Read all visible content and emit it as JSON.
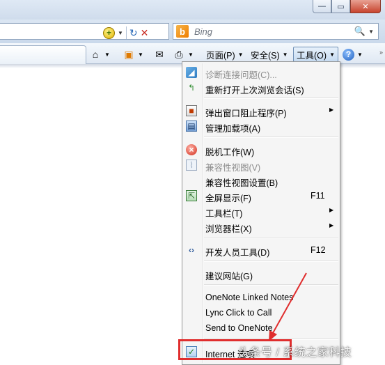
{
  "window": {
    "minimize_glyph": "—",
    "restore_glyph": "▭",
    "close_glyph": "✕"
  },
  "navbar": {
    "compat_glyph": "+",
    "dropdown_glyph": "▼",
    "refresh_glyph": "↻",
    "stop_glyph": "✕"
  },
  "search": {
    "brand_glyph": "b",
    "placeholder": "Bing",
    "go_glyph": "🔍",
    "dropdown_glyph": "▼"
  },
  "command_bar": {
    "home_glyph": "⌂",
    "feeds_glyph": "▣",
    "mail_glyph": "✉",
    "print_glyph": "⎙",
    "arrow_glyph": "▼",
    "page_label": "页面(P)",
    "safety_label": "安全(S)",
    "tools_label": "工具(O)",
    "help_glyph": "?",
    "grip_glyph": "»"
  },
  "menu": {
    "submenu_glyph": "▶",
    "items": [
      {
        "label": "诊断连接问题(C)...",
        "disabled": true,
        "icon": "diagnose-icon",
        "glyph": "◢"
      },
      {
        "label": "重新打开上次浏览会话(S)",
        "disabled": false,
        "icon": "reopen-session-icon",
        "glyph": "↰"
      },
      {
        "label": "弹出窗口阻止程序(P)",
        "disabled": false,
        "icon": "popup-blocker-icon",
        "glyph": "■"
      },
      {
        "label": "管理加载项(A)",
        "disabled": false,
        "icon": "addons-icon",
        "glyph": "▤"
      },
      {
        "label": "脱机工作(W)",
        "disabled": false,
        "icon": "work-offline-icon",
        "glyph": "×"
      },
      {
        "label": "兼容性视图(V)",
        "disabled": true,
        "icon": "compat-view-icon",
        "glyph": "⌇"
      },
      {
        "label": "兼容性视图设置(B)",
        "disabled": false
      },
      {
        "label": "全屏显示(F)",
        "shortcut": "F11",
        "disabled": false,
        "icon": "fullscreen-icon",
        "glyph": "⇱"
      },
      {
        "label": "工具栏(T)",
        "disabled": false
      },
      {
        "label": "浏览器栏(X)",
        "disabled": false
      },
      {
        "label": "开发人员工具(D)",
        "shortcut": "F12",
        "disabled": false,
        "icon": "developer-tools-icon",
        "glyph": "‹›"
      },
      {
        "label": "建议网站(G)",
        "disabled": false
      },
      {
        "label": "OneNote Linked Notes",
        "disabled": false
      },
      {
        "label": "Lync Click to Call",
        "disabled": false
      },
      {
        "label": "Send to OneNote",
        "disabled": false
      },
      {
        "label": "Internet 选项",
        "disabled": false,
        "icon": "internet-options-icon",
        "glyph": "✓"
      }
    ]
  },
  "annotation": {
    "highlight_color": "#e02d2d",
    "watermark": "头条号 / 系统之家科技"
  }
}
